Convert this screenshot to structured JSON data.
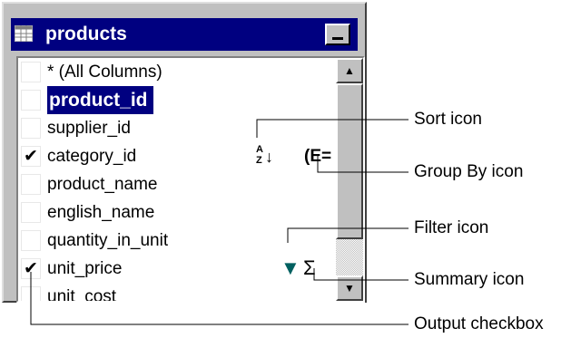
{
  "window": {
    "title": "products",
    "icon": "table-grid-icon"
  },
  "columns": [
    {
      "label": "* (All Columns)",
      "checked": false,
      "selected": false
    },
    {
      "label": "product_id",
      "checked": false,
      "selected": true
    },
    {
      "label": "supplier_id",
      "checked": false,
      "selected": false
    },
    {
      "label": "category_id",
      "checked": true,
      "selected": false
    },
    {
      "label": "product_name",
      "checked": false,
      "selected": false
    },
    {
      "label": "english_name",
      "checked": false,
      "selected": false
    },
    {
      "label": "quantity_in_unit",
      "checked": false,
      "selected": false
    },
    {
      "label": "unit_price",
      "checked": true,
      "selected": false
    },
    {
      "label": "unit_cost",
      "checked": false,
      "selected": false
    }
  ],
  "checkmark": "✔",
  "icons": {
    "sort": {
      "glyph_top": "A",
      "glyph_bottom": "Z",
      "arrow": "↓"
    },
    "group_by": {
      "glyph": "(E="
    },
    "filter": {
      "glyph": "▼"
    },
    "summary": {
      "glyph": "Σ"
    }
  },
  "callouts": {
    "sort": "Sort icon",
    "group_by": "Group By icon",
    "filter": "Filter icon",
    "summary": "Summary icon",
    "output": "Output checkbox"
  },
  "colors": {
    "title_bar": "#000080",
    "selection": "#000080",
    "window_face": "#c0c0c0",
    "filter_icon": "#006060"
  }
}
